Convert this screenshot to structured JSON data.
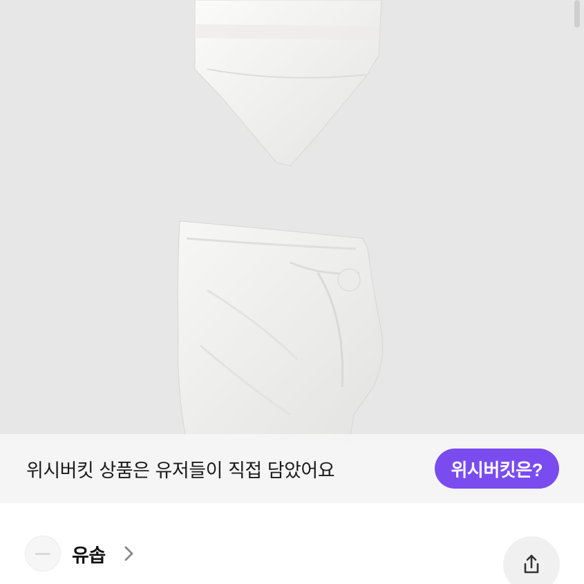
{
  "banner": {
    "text": "위시버킷 상품은 유저들이 직접 담았어요",
    "button_label": "위시버킷은?"
  },
  "seller": {
    "name": "유솝"
  },
  "icons": {
    "chevron": "chevron-right-icon",
    "share": "share-icon"
  },
  "colors": {
    "accent": "#7a4cf0",
    "image_background": "#e7e7e7"
  }
}
